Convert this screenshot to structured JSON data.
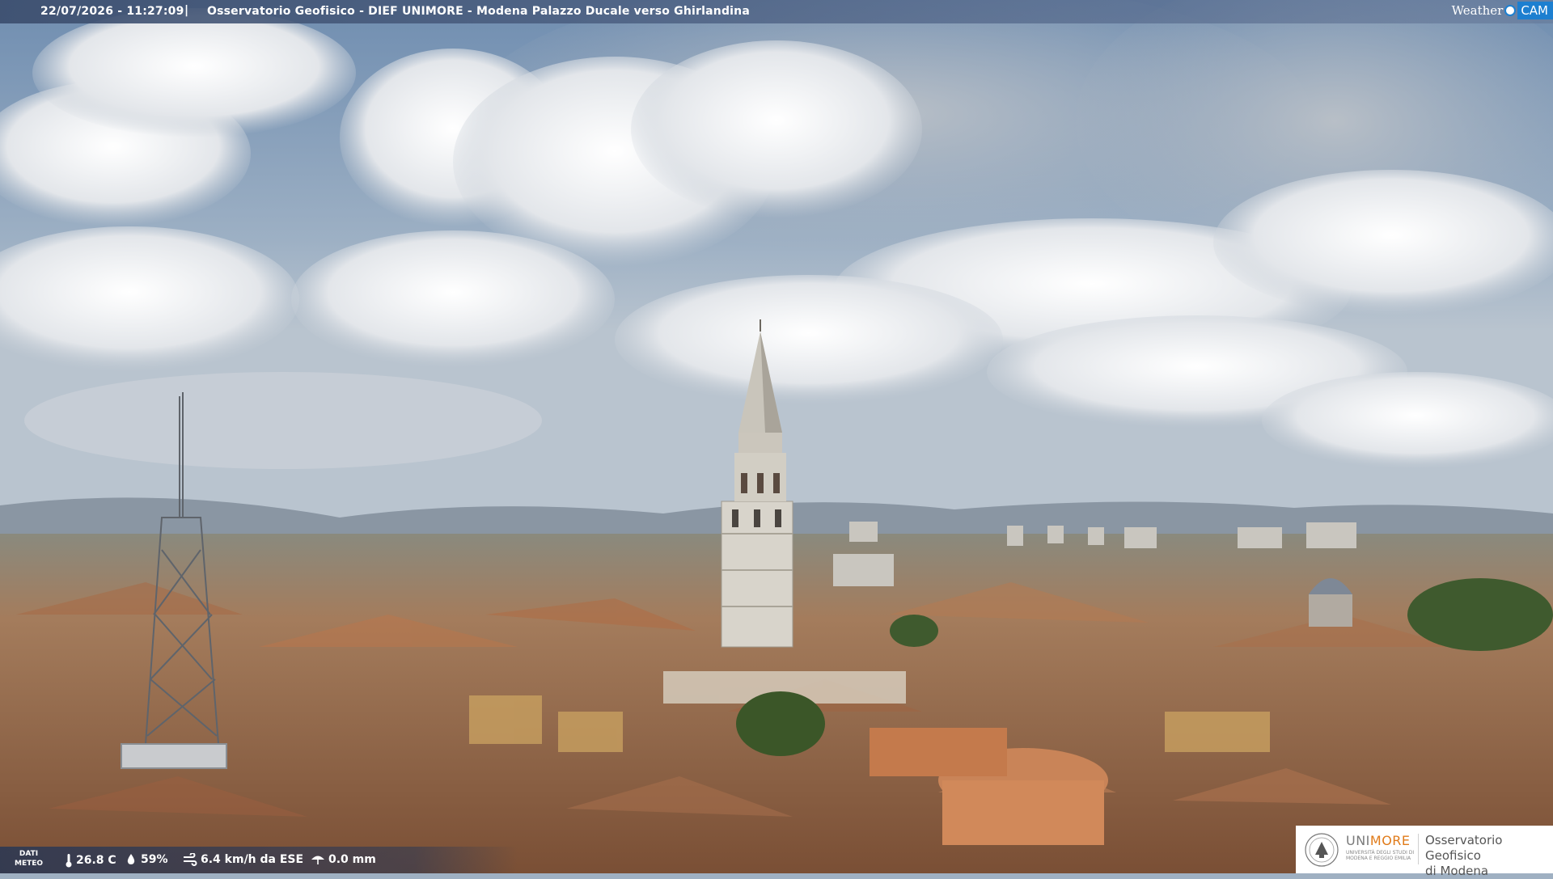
{
  "overlay": {
    "timestamp": "22/07/2026 - 11:27:09",
    "separator": "|",
    "title": "Osservatorio Geofisico - DIEF UNIMORE - Modena Palazzo Ducale verso Ghirlandina",
    "brand_weather": "Weather",
    "brand_cam": "CAM"
  },
  "meteo": {
    "label_line1": "DATI",
    "label_line2": "METEO",
    "temperature": "26.8 C",
    "humidity": "59%",
    "wind": "6.4 km/h da ESE",
    "rain": "0.0 mm"
  },
  "logo": {
    "uni_prefix": "UNI",
    "uni_suffix": "MORE",
    "uni_subtitle": "UNIVERSITÀ DEGLI STUDI DI MODENA E REGGIO EMILIA",
    "observatory_line1": "Osservatorio Geofisico",
    "observatory_line2": "di Modena"
  },
  "colors": {
    "sky_top": "#7f9ab9",
    "cloud": "#eef0f2",
    "roof": "#b57a52",
    "tower": "#d9d6cf",
    "accent": "#1d7fd0"
  }
}
